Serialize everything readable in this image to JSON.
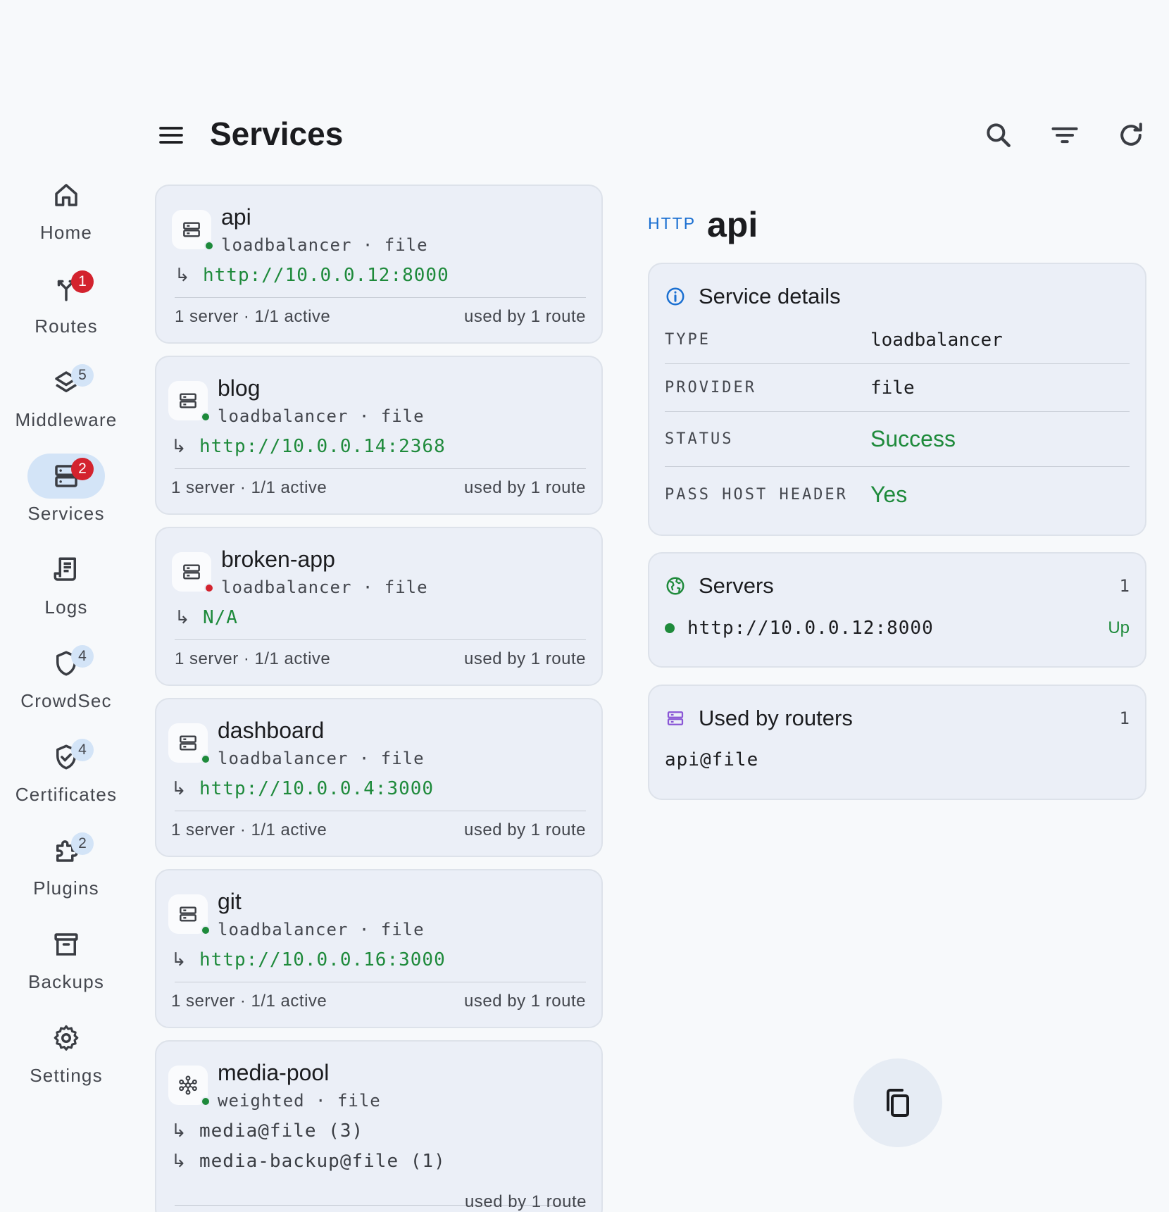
{
  "header": {
    "title": "Services",
    "menu_icon": "menu-icon",
    "actions": [
      "search-icon",
      "filter-icon",
      "refresh-icon"
    ]
  },
  "nav": {
    "items": [
      {
        "label": "Home",
        "icon": "home-icon",
        "badge": ""
      },
      {
        "label": "Routes",
        "icon": "routes-icon",
        "badge": "1"
      },
      {
        "label": "Middleware",
        "icon": "layers-icon",
        "badge": "5"
      },
      {
        "label": "Services",
        "icon": "server-icon",
        "badge": "2",
        "active": true
      },
      {
        "label": "Logs",
        "icon": "logs-icon",
        "badge": ""
      },
      {
        "label": "CrowdSec",
        "icon": "shield-icon",
        "badge": "4"
      },
      {
        "label": "Certificates",
        "icon": "certificate-icon",
        "badge": "4"
      },
      {
        "label": "Plugins",
        "icon": "puzzle-icon",
        "badge": "2"
      },
      {
        "label": "Backups",
        "icon": "archive-icon",
        "badge": ""
      },
      {
        "label": "Settings",
        "icon": "gear-icon",
        "badge": ""
      }
    ]
  },
  "services": [
    {
      "name": "api",
      "type": "loadbalancer",
      "provider": "file",
      "sep": "·",
      "arrow": "↳",
      "target": "http://10.0.0.12:8000",
      "servers": "1 server · 1/1 active",
      "used_by": "used by 1 route",
      "status": "ok"
    },
    {
      "name": "blog",
      "type": "loadbalancer",
      "provider": "file",
      "sep": "·",
      "arrow": "↳",
      "target": "http://10.0.0.14:2368",
      "servers": "1 server · 1/1 active",
      "used_by": "used by 1 route",
      "status": "ok"
    },
    {
      "name": "broken-app",
      "type": "loadbalancer",
      "provider": "file",
      "sep": "·",
      "arrow": "↳",
      "target": "N/A",
      "servers": "1 server · 1/1 active",
      "used_by": "used by 1 route",
      "status": "error"
    },
    {
      "name": "dashboard",
      "type": "loadbalancer",
      "provider": "file",
      "sep": "·",
      "arrow": "↳",
      "target": "http://10.0.0.4:3000",
      "servers": "1 server · 1/1 active",
      "used_by": "used by 1 route",
      "status": "ok"
    },
    {
      "name": "git",
      "type": "loadbalancer",
      "provider": "file",
      "sep": "·",
      "arrow": "↳",
      "target": "http://10.0.0.16:3000",
      "servers": "1 server · 1/1 active",
      "used_by": "used by 1 route",
      "status": "ok"
    },
    {
      "name": "media-pool",
      "type": "weighted",
      "provider": "file",
      "sep": "·",
      "arrow": "↳",
      "targets": [
        "media@file (3)",
        "media-backup@file (1)"
      ],
      "used_by": "used by 1 route",
      "status": "ok"
    }
  ],
  "detail": {
    "kind": "HTTP",
    "name": "api",
    "service_details": {
      "title": "Service details",
      "rows": [
        {
          "key": "TYPE",
          "value": "loadbalancer"
        },
        {
          "key": "PROVIDER",
          "value": "file"
        },
        {
          "key": "STATUS",
          "value": "Success"
        },
        {
          "key": "PASS HOST HEADER",
          "value": "Yes"
        }
      ]
    },
    "servers": {
      "title": "Servers",
      "count": "1",
      "items": [
        {
          "url": "http://10.0.0.12:8000",
          "state": "Up"
        }
      ]
    },
    "routers": {
      "title": "Used by routers",
      "count": "1",
      "items": [
        "api@file"
      ]
    }
  },
  "colors": {
    "accent": "#1a6fd1",
    "success": "#1e8a3b",
    "error": "#d3232e",
    "card_bg": "#ebeff7",
    "rail_active": "#d3e4f7"
  }
}
